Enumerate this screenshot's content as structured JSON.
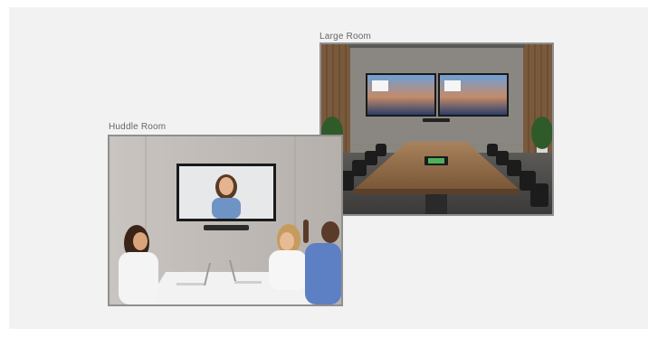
{
  "rooms": {
    "large": {
      "label": "Large Room",
      "scene_icon": "conference-room-illustration"
    },
    "huddle": {
      "label": "Huddle Room",
      "scene_icon": "huddle-meeting-illustration"
    }
  },
  "colors": {
    "canvas_bg": "#f2f2f2",
    "label_text": "#666666",
    "photo_border": "#8f8f8f"
  }
}
